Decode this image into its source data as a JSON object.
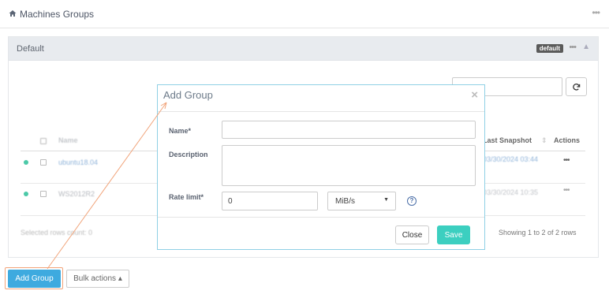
{
  "header": {
    "title": "Machines Groups",
    "icon": "home-icon",
    "more": "•••"
  },
  "panel": {
    "title": "Default",
    "badge": "default",
    "more": "•••",
    "collapse": "▲"
  },
  "table": {
    "columns": [
      "Name",
      "Last Snapshot",
      "Actions"
    ],
    "rows": [
      {
        "name": "ubuntu18.04",
        "snapshot": "03/30/2024 03:44",
        "status_color": "#4cc9a8",
        "actions": "•••"
      },
      {
        "name": "WS2012R2",
        "snapshot": "03/30/2024 10:35",
        "status_color": "#4cc9a8",
        "actions": "•••"
      }
    ],
    "footer_left": "Selected rows count: 0",
    "footer_right": "Showing 1 to 2 of 2 rows"
  },
  "buttons": {
    "add_group": "Add Group",
    "bulk_actions": "Bulk actions ▴"
  },
  "modal": {
    "title": "Add Group",
    "close_icon": "×",
    "name_label": "Name*",
    "name_value": "",
    "description_label": "Description",
    "description_value": "",
    "rate_label": "Rate limit*",
    "rate_value": "0",
    "rate_unit": "MiB/s",
    "help": "?",
    "close_button": "Close",
    "save_button": "Save"
  },
  "colors": {
    "accent": "#3eaadf",
    "save": "#3ccfc0",
    "annotation": "#f1a47a",
    "modal_border": "#8fd0e5"
  }
}
